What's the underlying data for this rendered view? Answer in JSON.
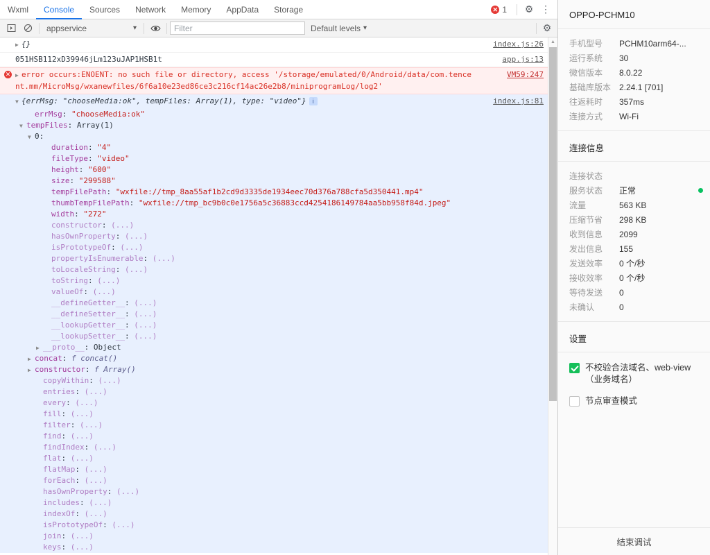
{
  "devtools": {
    "tabs": [
      {
        "label": "Wxml",
        "active": false
      },
      {
        "label": "Console",
        "active": true
      },
      {
        "label": "Sources",
        "active": false
      },
      {
        "label": "Network",
        "active": false
      },
      {
        "label": "Memory",
        "active": false
      },
      {
        "label": "AppData",
        "active": false
      },
      {
        "label": "Storage",
        "active": false
      }
    ],
    "error_badge": "1",
    "error_badge_glyph": "✕",
    "icons": {
      "settings_gear": "⚙",
      "more_vertical": "⋮",
      "sidebar_toggle": "▷",
      "clear_console": "⊘",
      "eye": "◉",
      "chevron_down": "▾",
      "scroll_up": "▲"
    },
    "filterbar": {
      "context": "appservice",
      "filter_placeholder": "Filter",
      "filter_value": "",
      "levels": "Default levels"
    }
  },
  "console": {
    "messages": [
      {
        "kind": "plain",
        "arrow": "right",
        "text": "{}",
        "source": "index.js:26"
      },
      {
        "kind": "plain",
        "arrow": "none",
        "text": "051HSB112xD39946jLm123uJAP1HSB1t",
        "source": "app.js:13"
      },
      {
        "kind": "error",
        "arrow": "right",
        "text": "error occurs:ENOENT: no such file or directory, access '/storage/emulated/0/Android/data/com.tencent.mm/MicroMsg/wxanewfiles/6f6a10e23ed86ce3c216cf14ac26e2b8/miniprogramLog/log2'",
        "source": "VM59:247"
      },
      {
        "kind": "object",
        "arrow": "down",
        "preview_prefix": "{",
        "preview": "errMsg: \"chooseMedia:ok\", tempFiles: Array(1), type: \"video\"}",
        "info_badge": "i",
        "source": "index.js:81"
      }
    ],
    "tree": [
      {
        "indent": 3,
        "arrow": "none",
        "key": "errMsg",
        "keystyle": "name",
        "sep": ": ",
        "val": "\"chooseMedia:ok\"",
        "valstyle": "str"
      },
      {
        "indent": 2,
        "arrow": "down",
        "key": "tempFiles",
        "keystyle": "name",
        "sep": ": ",
        "val": "Array(1)",
        "valstyle": "plain"
      },
      {
        "indent": 3,
        "arrow": "down",
        "key": "0",
        "keystyle": "plain",
        "sep": ":",
        "val": "",
        "valstyle": "plain"
      },
      {
        "indent": 5,
        "arrow": "none",
        "key": "duration",
        "keystyle": "name",
        "sep": ": ",
        "val": "\"4\"",
        "valstyle": "str"
      },
      {
        "indent": 5,
        "arrow": "none",
        "key": "fileType",
        "keystyle": "name",
        "sep": ": ",
        "val": "\"video\"",
        "valstyle": "str"
      },
      {
        "indent": 5,
        "arrow": "none",
        "key": "height",
        "keystyle": "name",
        "sep": ": ",
        "val": "\"600\"",
        "valstyle": "str"
      },
      {
        "indent": 5,
        "arrow": "none",
        "key": "size",
        "keystyle": "name",
        "sep": ": ",
        "val": "\"299588\"",
        "valstyle": "str"
      },
      {
        "indent": 5,
        "arrow": "none",
        "key": "tempFilePath",
        "keystyle": "name",
        "sep": ": ",
        "val": "\"wxfile://tmp_8aa55af1b2cd9d3335de1934eec70d376a788cfa5d350441.mp4\"",
        "valstyle": "str"
      },
      {
        "indent": 5,
        "arrow": "none",
        "key": "thumbTempFilePath",
        "keystyle": "name",
        "sep": ": ",
        "val": "\"wxfile://tmp_bc9b0c0e1756a5c36883ccd4254186149784aa5bb958f84d.jpeg\"",
        "valstyle": "str"
      },
      {
        "indent": 5,
        "arrow": "none",
        "key": "width",
        "keystyle": "name",
        "sep": ": ",
        "val": "\"272\"",
        "valstyle": "str"
      },
      {
        "indent": 5,
        "arrow": "none",
        "key": "constructor",
        "keystyle": "dim",
        "sep": ": ",
        "val": "(...)",
        "valstyle": "dim"
      },
      {
        "indent": 5,
        "arrow": "none",
        "key": "hasOwnProperty",
        "keystyle": "dim",
        "sep": ": ",
        "val": "(...)",
        "valstyle": "dim"
      },
      {
        "indent": 5,
        "arrow": "none",
        "key": "isPrototypeOf",
        "keystyle": "dim",
        "sep": ": ",
        "val": "(...)",
        "valstyle": "dim"
      },
      {
        "indent": 5,
        "arrow": "none",
        "key": "propertyIsEnumerable",
        "keystyle": "dim",
        "sep": ": ",
        "val": "(...)",
        "valstyle": "dim"
      },
      {
        "indent": 5,
        "arrow": "none",
        "key": "toLocaleString",
        "keystyle": "dim",
        "sep": ": ",
        "val": "(...)",
        "valstyle": "dim"
      },
      {
        "indent": 5,
        "arrow": "none",
        "key": "toString",
        "keystyle": "dim",
        "sep": ": ",
        "val": "(...)",
        "valstyle": "dim"
      },
      {
        "indent": 5,
        "arrow": "none",
        "key": "valueOf",
        "keystyle": "dim",
        "sep": ": ",
        "val": "(...)",
        "valstyle": "dim"
      },
      {
        "indent": 5,
        "arrow": "none",
        "key": "__defineGetter__",
        "keystyle": "dim",
        "sep": ": ",
        "val": "(...)",
        "valstyle": "dim"
      },
      {
        "indent": 5,
        "arrow": "none",
        "key": "__defineSetter__",
        "keystyle": "dim",
        "sep": ": ",
        "val": "(...)",
        "valstyle": "dim"
      },
      {
        "indent": 5,
        "arrow": "none",
        "key": "__lookupGetter__",
        "keystyle": "dim",
        "sep": ": ",
        "val": "(...)",
        "valstyle": "dim"
      },
      {
        "indent": 5,
        "arrow": "none",
        "key": "__lookupSetter__",
        "keystyle": "dim",
        "sep": ": ",
        "val": "(...)",
        "valstyle": "dim"
      },
      {
        "indent": 4,
        "arrow": "right",
        "key": "__proto__",
        "keystyle": "dim",
        "sep": ": ",
        "val": "Object",
        "valstyle": "plain"
      },
      {
        "indent": 3,
        "arrow": "right",
        "key": "concat",
        "keystyle": "name",
        "sep": ": ",
        "val": "f concat()",
        "valstyle": "fn"
      },
      {
        "indent": 3,
        "arrow": "right",
        "key": "constructor",
        "keystyle": "name",
        "sep": ": ",
        "val": "f Array()",
        "valstyle": "fn"
      },
      {
        "indent": 4,
        "arrow": "none",
        "key": "copyWithin",
        "keystyle": "dim",
        "sep": ": ",
        "val": "(...)",
        "valstyle": "dim"
      },
      {
        "indent": 4,
        "arrow": "none",
        "key": "entries",
        "keystyle": "dim",
        "sep": ": ",
        "val": "(...)",
        "valstyle": "dim"
      },
      {
        "indent": 4,
        "arrow": "none",
        "key": "every",
        "keystyle": "dim",
        "sep": ": ",
        "val": "(...)",
        "valstyle": "dim"
      },
      {
        "indent": 4,
        "arrow": "none",
        "key": "fill",
        "keystyle": "dim",
        "sep": ": ",
        "val": "(...)",
        "valstyle": "dim"
      },
      {
        "indent": 4,
        "arrow": "none",
        "key": "filter",
        "keystyle": "dim",
        "sep": ": ",
        "val": "(...)",
        "valstyle": "dim"
      },
      {
        "indent": 4,
        "arrow": "none",
        "key": "find",
        "keystyle": "dim",
        "sep": ": ",
        "val": "(...)",
        "valstyle": "dim"
      },
      {
        "indent": 4,
        "arrow": "none",
        "key": "findIndex",
        "keystyle": "dim",
        "sep": ": ",
        "val": "(...)",
        "valstyle": "dim"
      },
      {
        "indent": 4,
        "arrow": "none",
        "key": "flat",
        "keystyle": "dim",
        "sep": ": ",
        "val": "(...)",
        "valstyle": "dim"
      },
      {
        "indent": 4,
        "arrow": "none",
        "key": "flatMap",
        "keystyle": "dim",
        "sep": ": ",
        "val": "(...)",
        "valstyle": "dim"
      },
      {
        "indent": 4,
        "arrow": "none",
        "key": "forEach",
        "keystyle": "dim",
        "sep": ": ",
        "val": "(...)",
        "valstyle": "dim"
      },
      {
        "indent": 4,
        "arrow": "none",
        "key": "hasOwnProperty",
        "keystyle": "dim",
        "sep": ": ",
        "val": "(...)",
        "valstyle": "dim"
      },
      {
        "indent": 4,
        "arrow": "none",
        "key": "includes",
        "keystyle": "dim",
        "sep": ": ",
        "val": "(...)",
        "valstyle": "dim"
      },
      {
        "indent": 4,
        "arrow": "none",
        "key": "indexOf",
        "keystyle": "dim",
        "sep": ": ",
        "val": "(...)",
        "valstyle": "dim"
      },
      {
        "indent": 4,
        "arrow": "none",
        "key": "isPrototypeOf",
        "keystyle": "dim",
        "sep": ": ",
        "val": "(...)",
        "valstyle": "dim"
      },
      {
        "indent": 4,
        "arrow": "none",
        "key": "join",
        "keystyle": "dim",
        "sep": ": ",
        "val": "(...)",
        "valstyle": "dim"
      },
      {
        "indent": 4,
        "arrow": "none",
        "key": "keys",
        "keystyle": "dim",
        "sep": ": ",
        "val": "(...)",
        "valstyle": "dim"
      }
    ]
  },
  "panel": {
    "device_title": "OPPO-PCHM10",
    "device_info": [
      {
        "k": "手机型号",
        "v": "PCHM10arm64-...",
        "dot": false
      },
      {
        "k": "运行系统",
        "v": "30",
        "dot": false
      },
      {
        "k": "微信版本",
        "v": "8.0.22",
        "dot": false
      },
      {
        "k": "基础库版本",
        "v": "2.24.1 [701]",
        "dot": false
      },
      {
        "k": "往返耗时",
        "v": "357ms",
        "dot": false
      },
      {
        "k": "连接方式",
        "v": "Wi-Fi",
        "dot": false
      }
    ],
    "connection_title": "连接信息",
    "connection_info": [
      {
        "k": "连接状态",
        "v": "",
        "dot": true,
        "dot_right": false
      },
      {
        "k": "服务状态",
        "v": "正常",
        "dot": false,
        "dot_right": true
      },
      {
        "k": "流量",
        "v": "563 KB",
        "dot": false,
        "dot_right": false
      },
      {
        "k": "压缩节省",
        "v": "298 KB",
        "dot": false,
        "dot_right": false
      },
      {
        "k": "收到信息",
        "v": "2099",
        "dot": false,
        "dot_right": false
      },
      {
        "k": "发出信息",
        "v": "155",
        "dot": false,
        "dot_right": false
      },
      {
        "k": "发送效率",
        "v": "0 个/秒",
        "dot": false,
        "dot_right": false
      },
      {
        "k": "接收效率",
        "v": "0 个/秒",
        "dot": false,
        "dot_right": false
      },
      {
        "k": "等待发送",
        "v": "0",
        "dot": false,
        "dot_right": false
      },
      {
        "k": "未确认",
        "v": "0",
        "dot": false,
        "dot_right": false
      }
    ],
    "settings_title": "设置",
    "settings_options": [
      {
        "label": "不校验合法域名、web-view（业务域名）",
        "checked": true
      },
      {
        "label": "节点审查模式",
        "checked": false
      }
    ],
    "end_button": "结束调试",
    "accent_green": "#07c160",
    "accent_blue": "#1a73e8",
    "error_red": "#d93025"
  }
}
